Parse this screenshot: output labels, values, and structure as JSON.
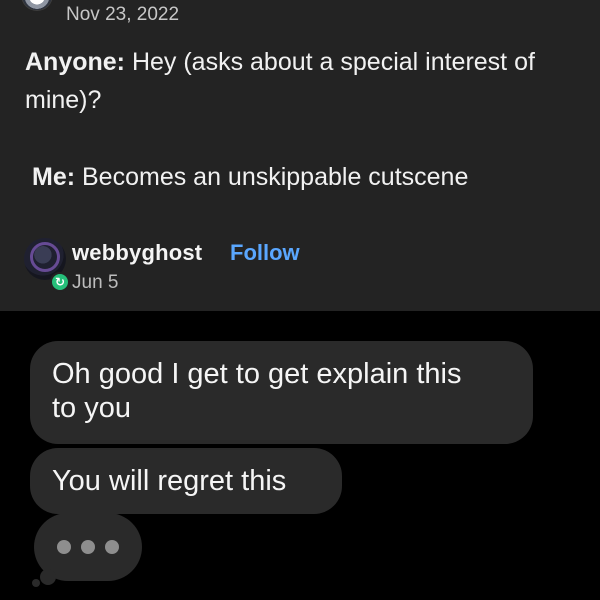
{
  "post": {
    "date": "Nov 23, 2022",
    "line1": {
      "who": "Anyone:",
      "text": " Hey (asks about a special interest of"
    },
    "line2": {
      "text": "mine)?"
    },
    "line3": {
      "who": "Me:",
      "text": " Becomes an unskippable cutscene"
    }
  },
  "reply": {
    "username": "webbyghost",
    "follow_label": "Follow",
    "date": "Jun 5",
    "badge_icon": "reblog-icon",
    "badge_color": "#26c07a"
  },
  "messages": {
    "bubble1": {
      "line1": "Oh good I get to get explain this",
      "line2": "to you"
    },
    "bubble2": {
      "text": "You will regret this"
    }
  },
  "colors": {
    "post_bg": "#232323",
    "messages_bg": "#000000",
    "bubble_bg": "#2a2a2a",
    "link": "#5aa7ff"
  }
}
